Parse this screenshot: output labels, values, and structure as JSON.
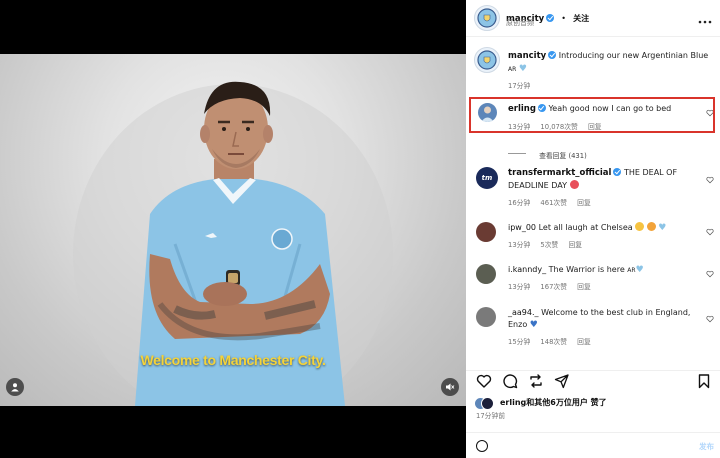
{
  "header": {
    "username": "mancity",
    "separator": "•",
    "follow_label": "关注",
    "subtitle": "原创音频",
    "more_icon": "ellipsis-icon"
  },
  "media": {
    "caption": "Welcome to Manchester City.",
    "user_icon": "user-tag-icon",
    "mute_icon": "speaker-muted-icon"
  },
  "caption_post": {
    "username": "mancity",
    "text": "Introducing our new Argentinian Blue",
    "text_line2": "AR",
    "time": "17分钟"
  },
  "comments": [
    {
      "username": "erling",
      "verified": true,
      "text": "Yeah good now I can go to bed",
      "time": "13分钟",
      "likes": "10,078次赞",
      "reply": "回复",
      "view_replies": "查看回复 (431)",
      "avatar_color": "#5d86b9"
    },
    {
      "username": "transfermarkt_official",
      "verified": true,
      "text": "THE DEAL OF",
      "text_line2": "DEADLINE DAY",
      "time": "16分钟",
      "likes": "461次赞",
      "reply": "回复",
      "avatar_color": "#1a2a5a",
      "avatar_text": "tm"
    },
    {
      "username": "ipw_00",
      "verified": false,
      "text": "Let all laugh at Chelsea",
      "time": "13分钟",
      "likes": "5次赞",
      "reply": "回复",
      "avatar_color": "#6a3b33"
    },
    {
      "username": "i.kanndy_",
      "verified": false,
      "text": "The Warrior is here",
      "text_suffix": "AR",
      "time": "13分钟",
      "likes": "167次赞",
      "reply": "回复",
      "avatar_color": "#5b5e52"
    },
    {
      "username": "_aa94._",
      "verified": false,
      "text": "Welcome to the best club in England,",
      "text_line2": "Enzo",
      "time": "15分钟",
      "likes": "148次赞",
      "reply": "回复",
      "avatar_color": "#7a7a7a"
    }
  ],
  "actions": {
    "like_icon": "heart-icon",
    "comment_icon": "comment-icon",
    "repost_icon": "repost-icon",
    "share_icon": "send-icon",
    "save_icon": "bookmark-icon"
  },
  "likes": {
    "text": "erling和其他6万位用户 赞了",
    "time": "17分钟前"
  },
  "add_comment": {
    "placeholder": "",
    "post_label": "发布"
  },
  "colors": {
    "accent": "#3897f0",
    "highlight": "#d9342b",
    "caption": "#f4d33a",
    "city_blue": "#8cc4e6"
  }
}
